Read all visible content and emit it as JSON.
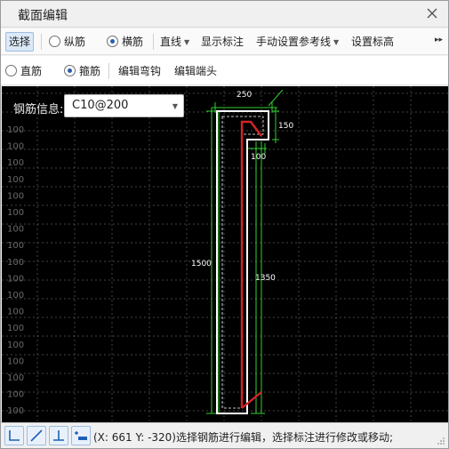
{
  "window": {
    "title": "截面编辑"
  },
  "toolbar1": {
    "select_label": "选择",
    "radio_longitudinal": "纵筋",
    "radio_transverse": "横筋",
    "line_dropdown": "直线",
    "show_dimension": "显示标注",
    "manual_reference": "手动设置参考线",
    "set_elevation": "设置标高",
    "more": "▸▸"
  },
  "toolbar2": {
    "radio_straight": "直筋",
    "radio_stirrup": "箍筋",
    "edit_hook": "编辑弯钩",
    "edit_end": "编辑端头"
  },
  "canvas": {
    "rebar_info_label": "钢筋信息:",
    "rebar_info_value": "C10@200",
    "grid_labels": [
      "100",
      "100",
      "100",
      "100",
      "100",
      "100",
      "100",
      "100",
      "100",
      "100",
      "100",
      "100",
      "100",
      "100",
      "100",
      "100",
      "100",
      "100",
      "100"
    ],
    "dimensions": {
      "top_width": "250",
      "right_top": "150",
      "inner_step": "100",
      "total_height": "1500",
      "inner_height": "1350"
    },
    "colors": {
      "dimension_line": "#2fd12f",
      "rebar": "#d42424",
      "section_outline": "#ffffff",
      "grid": "#5a5a5a"
    }
  },
  "statusbar": {
    "message": "(X: 661 Y: -320)选择钢筋进行编辑，选择标注进行修改或移动;"
  }
}
